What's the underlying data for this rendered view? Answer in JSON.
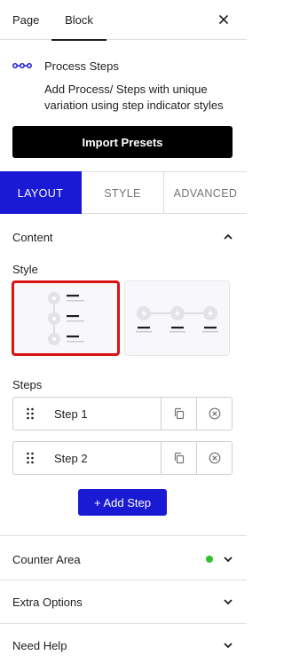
{
  "top_tabs": {
    "page": "Page",
    "block": "Block"
  },
  "block": {
    "title": "Process Steps",
    "description": "Add Process/ Steps with unique variation using step indicator styles",
    "icon": "process-steps-icon"
  },
  "import_presets_label": "Import Presets",
  "panel_tabs": {
    "layout": "LAYOUT",
    "style": "STYLE",
    "advanced": "ADVANCED"
  },
  "content": {
    "label": "Content",
    "style_label": "Style",
    "selected_style": "vertical",
    "steps_label": "Steps",
    "steps": [
      {
        "label": "Step 1"
      },
      {
        "label": "Step 2"
      }
    ],
    "add_step_label": "+ Add Step"
  },
  "sections": {
    "counter_area": "Counter Area",
    "extra_options": "Extra Options",
    "need_help": "Need Help"
  },
  "colors": {
    "accent": "#1a1ad4",
    "selected_outline": "#dd1111",
    "status_dot": "#2cc42c"
  }
}
